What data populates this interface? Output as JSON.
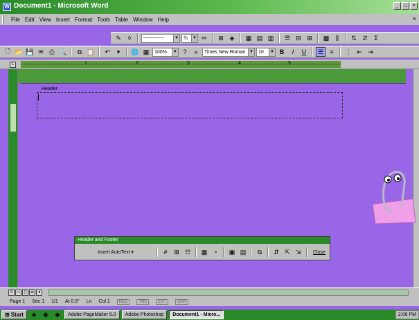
{
  "window": {
    "title": "Document1 - Microsoft Word",
    "app_icon": "W"
  },
  "window_buttons": [
    "_",
    "□",
    "×"
  ],
  "menu": {
    "items": [
      "File",
      "Edit",
      "View",
      "Insert",
      "Format",
      "Tools",
      "Table",
      "Window",
      "Help"
    ],
    "doc_close": "×"
  },
  "drawing_toolbar": {
    "line_weight": "¾"
  },
  "standard_toolbar": {
    "zoom": "100%",
    "font": "Times New Roman",
    "font_size": "10",
    "bold": "B",
    "italic": "I",
    "underline": "U"
  },
  "ruler": {
    "numbers": [
      "1",
      "2",
      "3",
      "4",
      "5"
    ]
  },
  "document": {
    "header_label": "Header"
  },
  "header_footer_toolbar": {
    "title": "Header and Footer",
    "insert_autotext": "Insert AutoText ▾",
    "close": "Close"
  },
  "status": {
    "page": "Page 1",
    "section": "Sec 1",
    "pages": "1/1",
    "at": "At 0.5\"",
    "ln": "Ln",
    "col": "Col 1",
    "rec": "REC",
    "trk": "TRK",
    "ext": "EXT",
    "ovr": "OVR"
  },
  "taskbar": {
    "start": "Start",
    "tasks": [
      "Adobe PageMaker 6.0",
      "Adobe Photoshop",
      "Document1 - Micro..."
    ],
    "clock": "2:06 PM"
  },
  "colors": {
    "accent": "#2a8a2a",
    "page": "#9966e8"
  }
}
